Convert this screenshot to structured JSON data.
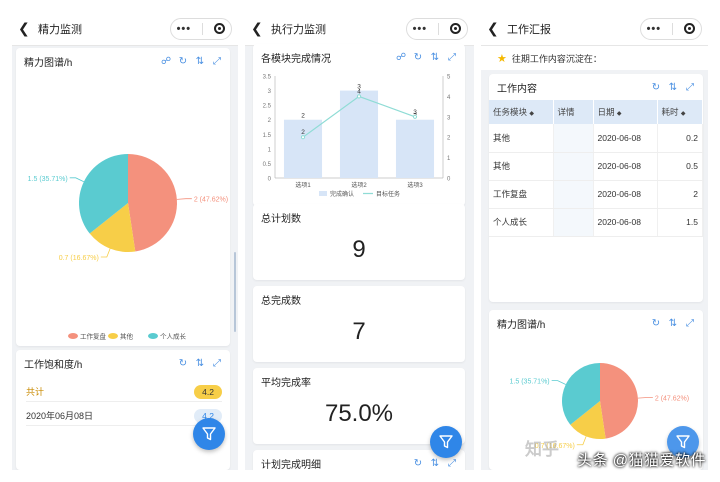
{
  "phones": [
    {
      "title": "精力监测",
      "cards": {
        "energy": {
          "title": "精力图谱/h"
        },
        "saturation": {
          "title": "工作饱和度/h",
          "rows": [
            {
              "label": "共计",
              "value": "4.2"
            },
            {
              "label": "2020年06月08日",
              "value": "4.2"
            }
          ]
        }
      }
    },
    {
      "title": "执行力监测",
      "cards": {
        "modules": {
          "title": "各模块完成情况"
        },
        "planned": {
          "title": "总计划数",
          "value": "9"
        },
        "completed": {
          "title": "总完成数",
          "value": "7"
        },
        "rate": {
          "title": "平均完成率",
          "value": "75.0%"
        },
        "detail": {
          "title": "计划完成明细"
        }
      }
    },
    {
      "title": "工作汇报",
      "notice": "往期工作内容沉淀在：",
      "cards": {
        "work": {
          "title": "工作内容",
          "columns": [
            "任务模块",
            "详情",
            "日期",
            "耗时"
          ],
          "rows": [
            [
              "其他",
              "",
              "2020-06-08",
              "0.2"
            ],
            [
              "其他",
              "",
              "2020-06-08",
              "0.5"
            ],
            [
              "工作复盘",
              "",
              "2020-06-08",
              "2"
            ],
            [
              "个人成长",
              "",
              "2020-06-08",
              "1.5"
            ]
          ]
        },
        "energy": {
          "title": "精力图谱/h"
        }
      }
    }
  ],
  "colors": {
    "accent": "#2f86e8",
    "review": "#f4917d",
    "other": "#f7ce48",
    "growth": "#5acbd0",
    "bar": "#d7e5f7",
    "line": "#8fdcd5",
    "badge_yellow": "#f7ce48",
    "badge_blue": "#e1ecf8"
  },
  "chart_data": [
    {
      "type": "pie",
      "categories": [
        "工作复盘",
        "其他",
        "个人成长"
      ],
      "values": [
        2,
        0.7,
        1.5
      ],
      "labels": [
        "2 (47.62%)",
        "0.7 (16.67%)",
        "1.5 (35.71%)"
      ],
      "legend": [
        "工作复盘",
        "其他",
        "个人成长"
      ],
      "legend_position": "bottom"
    },
    {
      "type": "bar",
      "categories": [
        "选项1",
        "选项2",
        "选项3"
      ],
      "series": [
        {
          "name": "完成确认",
          "type": "bar",
          "values": [
            2,
            3,
            2
          ]
        },
        {
          "name": "目标任务",
          "type": "line",
          "values": [
            2,
            4,
            3
          ]
        }
      ],
      "bar_labels": [
        "2",
        "3",
        "2"
      ],
      "line_labels": [
        "2",
        "4",
        "3"
      ],
      "ylim_left": [
        0,
        3.5
      ],
      "yticks_left": [
        "0",
        "0.5",
        "1",
        "1.5",
        "2",
        "2.5",
        "3",
        "3.5"
      ],
      "ylim_right": [
        0,
        5
      ],
      "yticks_right": [
        "0",
        "1",
        "2",
        "3",
        "4",
        "5"
      ],
      "legend_position": "bottom"
    },
    {
      "type": "pie",
      "categories": [
        "工作复盘",
        "其他",
        "个人成长"
      ],
      "values": [
        2,
        0.7,
        1.5
      ],
      "labels": [
        "2 (47.62%)",
        "0.7 (16.67%)",
        "1.5 (35.71%)"
      ]
    }
  ],
  "watermark": "头条 @猫猫爱软件",
  "watermark2": "知乎"
}
